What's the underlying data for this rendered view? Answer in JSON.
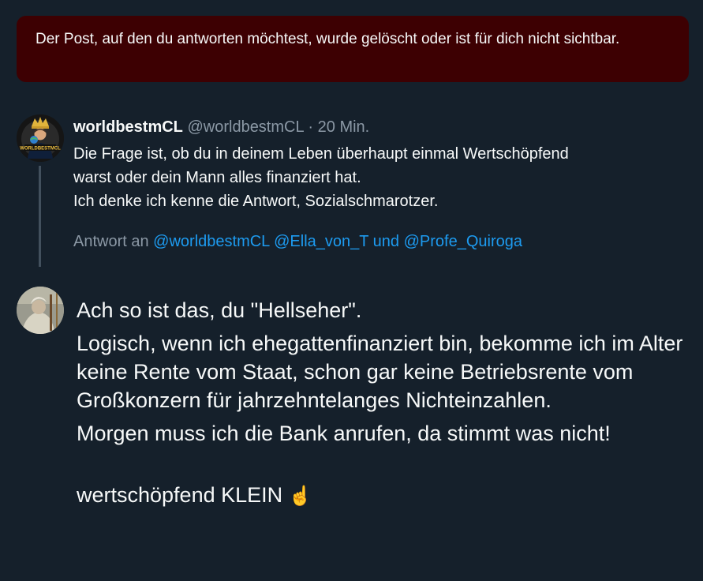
{
  "notice": {
    "text": "Der Post, auf den du antworten möchtest, wurde gelöscht oder ist für dich nicht sichtbar."
  },
  "parent_post": {
    "display_name": "worldbestmCL",
    "handle": "@worldbestmCL",
    "separator": " · ",
    "time": "20 Min.",
    "lines": [
      "Die Frage ist, ob du in deinem Leben überhaupt einmal Wertschöpfend",
      "warst oder dein Mann alles finanziert hat.",
      "Ich denke ich kenne die Antwort, Sozialschmarotzer."
    ],
    "avatar_badge": "WORLDBESTMCL",
    "reply_prefix": "Antwort an ",
    "reply_mentions": [
      "@worldbestmCL",
      "@Ella_von_T",
      "@Profe_Quiroga"
    ],
    "reply_and": " und "
  },
  "compose": {
    "paragraphs": [
      "Ach so ist das, du \"Hellseher\".",
      "Logisch, wenn ich ehegattenfinanziert bin, bekomme ich im Alter keine Rente vom Staat, schon gar keine Betriebsrente vom Großkonzern für jahrzehntelanges Nichteinzahlen.",
      "Morgen muss ich die Bank anrufen, da stimmt was nicht!"
    ],
    "last_line": "wertschöpfend KLEIN",
    "emoji": "☝"
  },
  "colors": {
    "background": "#15202b",
    "notice_bg": "#3d0002",
    "mention": "#1d9bf0",
    "muted": "#8b98a5"
  }
}
